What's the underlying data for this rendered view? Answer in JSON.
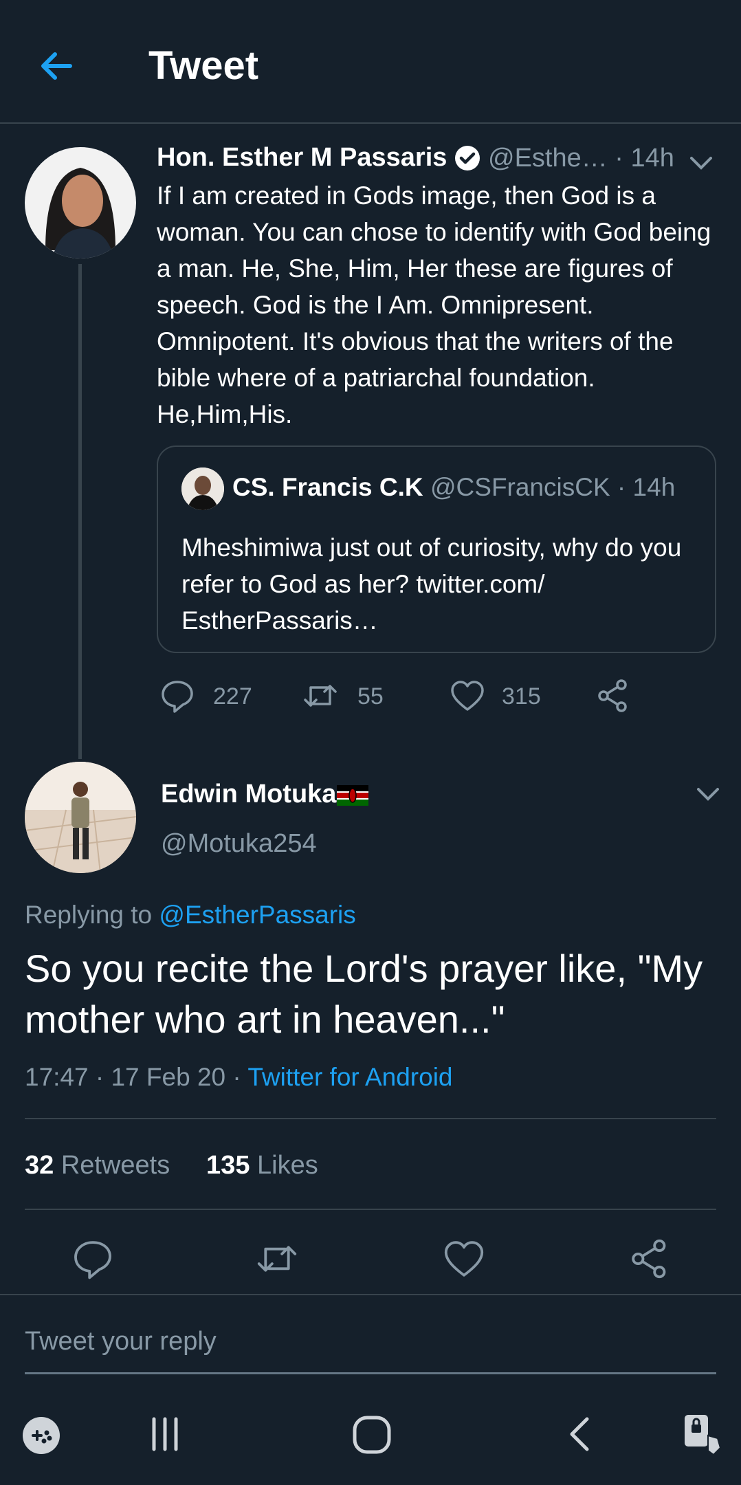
{
  "header": {
    "title": "Tweet"
  },
  "parent_tweet": {
    "name": "Hon. Esther M Passaris",
    "handle_time": "@Esthe… · 14h",
    "text": "If I am created in Gods image, then God is a woman. You can chose to identify with God being a man. He, She, Him, Her these are figures of speech. God is the I Am. Omnipresent. Omnipotent.  It's obvious that the writers of the bible where of a patriarchal foundation. He,Him,His.",
    "quote": {
      "name": "CS. Francis C.K",
      "handle_time": "@CSFrancisCK · 14h",
      "text": "Mheshimiwa just out of curiosity, why do you refer to God as her? twitter.com/ EstherPassaris…"
    },
    "replies": "227",
    "retweets": "55",
    "likes": "315"
  },
  "main_tweet": {
    "name": "Edwin Motuka",
    "handle": "@Motuka254",
    "replying_prefix": "Replying to ",
    "replying_to": "@EstherPassaris",
    "text": "So you recite the Lord's prayer like, \"My mother who art in heaven...\"",
    "time_date": "17:47 · 17 Feb 20 · ",
    "source": "Twitter for Android",
    "retweets_count": "32",
    "retweets_label": " Retweets",
    "likes_count": "135",
    "likes_label": " Likes"
  },
  "composer": {
    "placeholder": "Tweet your reply"
  },
  "colors": {
    "background": "#15202b",
    "accent": "#1da1f2",
    "muted": "#8899a6",
    "border": "#38444d"
  }
}
